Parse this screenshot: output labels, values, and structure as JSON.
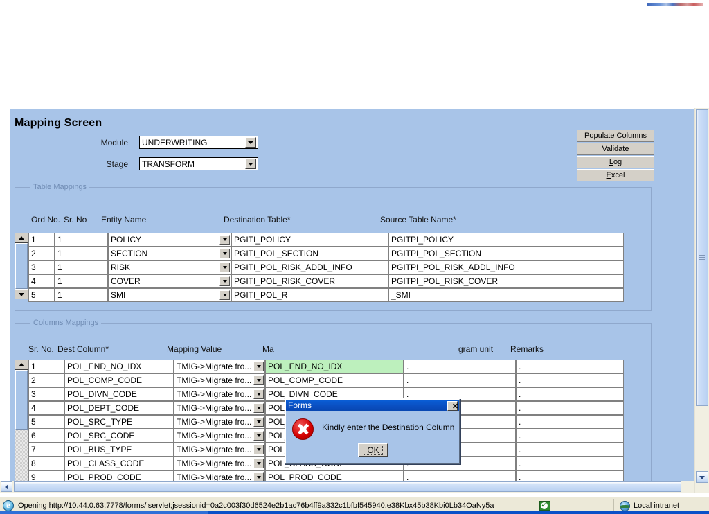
{
  "app": {
    "screen_title": "Mapping Screen"
  },
  "form": {
    "module": {
      "label": "Module",
      "value": "UNDERWRITING"
    },
    "stage": {
      "label": "Stage",
      "value": "TRANSFORM"
    }
  },
  "actions": {
    "populate_columns": "Populate Columns",
    "validate": "Validate",
    "log": "Log",
    "excel": "Excel"
  },
  "table_mappings": {
    "legend": "Table Mappings",
    "headers": {
      "ord_no": "Ord No.",
      "sr_no": "Sr. No",
      "entity_name": "Entity Name",
      "destination_table": "Destination Table*",
      "source_table": "Source Table Name*"
    },
    "rows": [
      {
        "ord_no": "1",
        "sr_no": "1",
        "entity_name": "POLICY",
        "destination_table": "PGITI_POLICY",
        "source_table": "PGITPI_POLICY"
      },
      {
        "ord_no": "2",
        "sr_no": "1",
        "entity_name": "SECTION",
        "destination_table": "PGITI_POL_SECTION",
        "source_table": "PGITPI_POL_SECTION"
      },
      {
        "ord_no": "3",
        "sr_no": "1",
        "entity_name": "RISK",
        "destination_table": "PGITI_POL_RISK_ADDL_INFO",
        "source_table": "PGITPI_POL_RISK_ADDL_INFO"
      },
      {
        "ord_no": "4",
        "sr_no": "1",
        "entity_name": "COVER",
        "destination_table": "PGITI_POL_RISK_COVER",
        "source_table": "PGITPI_POL_RISK_COVER"
      },
      {
        "ord_no": "5",
        "sr_no": "1",
        "entity_name": "SMI",
        "destination_table": "PGITI_POL_R",
        "source_table": "_SMI"
      }
    ]
  },
  "columns_mappings": {
    "legend": "Columns Mappings",
    "headers": {
      "sr_no": "Sr. No.",
      "dest_column": "Dest Column*",
      "mapping_value": "Mapping Value",
      "mapping_column": "Ma",
      "program_unit": "gram unit",
      "remarks": "Remarks"
    },
    "rows": [
      {
        "sr_no": "1",
        "dest_column": "POL_END_NO_IDX",
        "mapping_value": "TMIG->Migrate fro...",
        "mapping_column": "POL_END_NO_IDX",
        "program_unit": ".",
        "remarks": "."
      },
      {
        "sr_no": "2",
        "dest_column": "POL_COMP_CODE",
        "mapping_value": "TMIG->Migrate fro...",
        "mapping_column": "POL_COMP_CODE",
        "program_unit": ".",
        "remarks": "."
      },
      {
        "sr_no": "3",
        "dest_column": "POL_DIVN_CODE",
        "mapping_value": "TMIG->Migrate fro...",
        "mapping_column": "POL_DIVN_CODE",
        "program_unit": ".",
        "remarks": "."
      },
      {
        "sr_no": "4",
        "dest_column": "POL_DEPT_CODE",
        "mapping_value": "TMIG->Migrate fro...",
        "mapping_column": "POL_DEPT_CODE",
        "program_unit": ".",
        "remarks": "."
      },
      {
        "sr_no": "5",
        "dest_column": "POL_SRC_TYPE",
        "mapping_value": "TMIG->Migrate fro...",
        "mapping_column": "POL_SRC_TYPE",
        "program_unit": ".",
        "remarks": "."
      },
      {
        "sr_no": "6",
        "dest_column": "POL_SRC_CODE",
        "mapping_value": "TMIG->Migrate fro...",
        "mapping_column": "POL_SRC_CODE",
        "program_unit": ".",
        "remarks": "."
      },
      {
        "sr_no": "7",
        "dest_column": "POL_BUS_TYPE",
        "mapping_value": "TMIG->Migrate fro...",
        "mapping_column": "POL_BUS_TYPE",
        "program_unit": ".",
        "remarks": "."
      },
      {
        "sr_no": "8",
        "dest_column": "POL_CLASS_CODE",
        "mapping_value": "TMIG->Migrate fro...",
        "mapping_column": "POL_CLASS_CODE",
        "program_unit": ".",
        "remarks": "."
      },
      {
        "sr_no": "9",
        "dest_column": "POL_PROD_CODE",
        "mapping_value": "TMIG->Migrate fro...",
        "mapping_column": "POL_PROD_CODE",
        "program_unit": ".",
        "remarks": "."
      }
    ]
  },
  "dialog": {
    "title": "Forms",
    "close_label": "✕",
    "message": "Kindly enter the Destination Column",
    "ok_label": "OK",
    "ok_accel": "O",
    "ok_rest": "K"
  },
  "statusbar": {
    "message": "Opening http://10.44.0.63:7778/forms/lservlet;jsessionid=0a2c003f30d6524e2b1ac76b4ff9a332c1bfbf545940.e38Kbx45b38Kbi0Lb34OaNy5a",
    "zone": "Local intranet"
  },
  "colors": {
    "form_background": "#a8c4e8",
    "highlight_cell": "#bdf0bd",
    "titlebar": "#0a4ec0",
    "error_icon": "#d40000",
    "button_face": "#d4d0c8"
  }
}
